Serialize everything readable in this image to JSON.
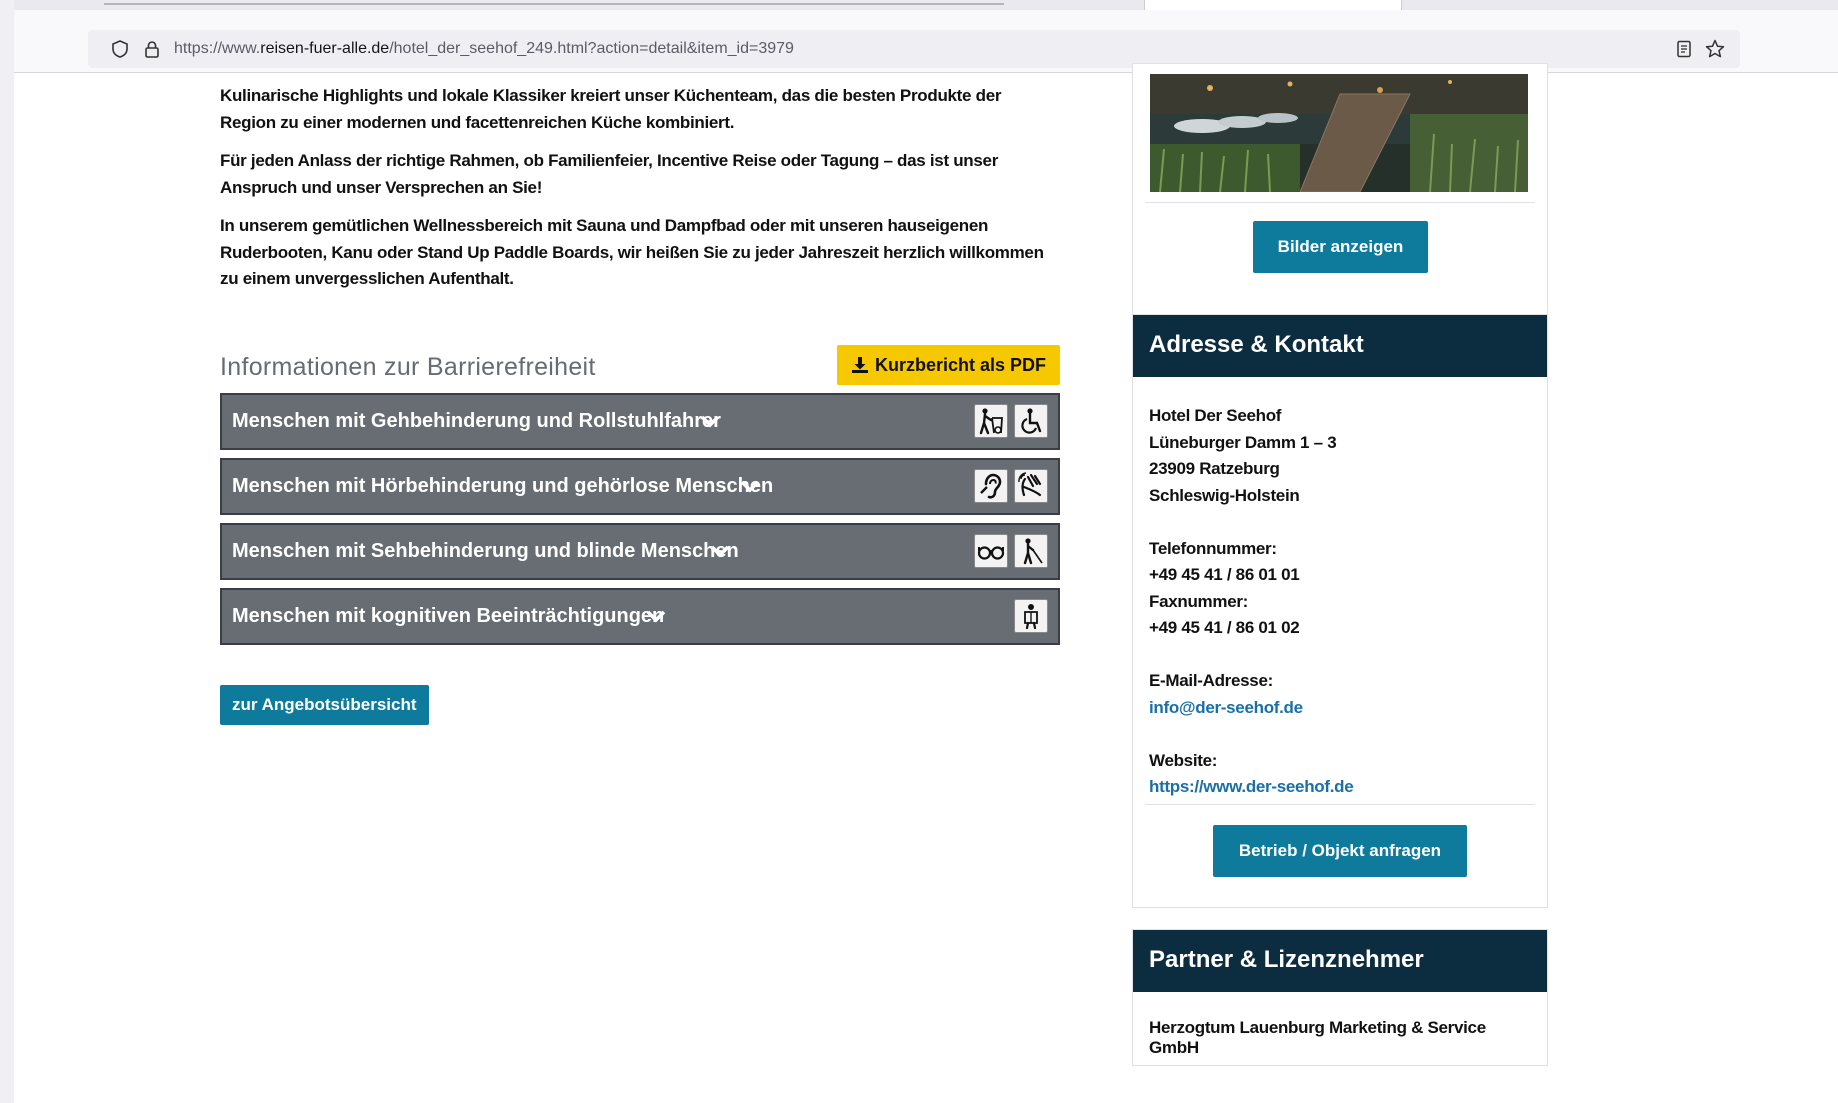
{
  "browser": {
    "url_prefix": "https://www.",
    "url_host": "reisen-fuer-alle.de",
    "url_path": "/hotel_der_seehof_249.html?action=detail&item_id=3979"
  },
  "content": {
    "paragraphs": [
      "Kulinarische Highlights und lokale Klassiker kreiert unser Küchenteam, das die besten Produkte der Region zu einer modernen und facettenreichen Küche kombiniert.",
      "Für jeden Anlass der richtige Rahmen, ob Familienfeier, Incentive Reise oder Tagung – das ist unser Anspruch und unser Versprechen an Sie!",
      "In unserem gemütlichen Wellnessbereich mit Sauna und Dampfbad oder mit unseren hauseigenen Ruderbooten, Kanu oder Stand Up Paddle Boards, wir heißen Sie zu jeder Jahreszeit herzlich willkommen zu einem unvergesslichen Aufenthalt."
    ]
  },
  "accessibility": {
    "title": "Informationen zur Barrierefreiheit",
    "pdf_button": "Kurzbericht als PDF",
    "items": [
      {
        "label": "Menschen mit Gehbehinderung und Rollstuhlfahrer"
      },
      {
        "label": "Menschen mit Hörbehinderung und gehörlose Menschen"
      },
      {
        "label": "Menschen mit Sehbehinderung und blinde Menschen"
      },
      {
        "label": "Menschen mit kognitiven Beeinträchtigungen"
      }
    ],
    "icons": [
      "walking-aid-icon",
      "wheelchair-icon",
      "ear-icon",
      "sign-language-icon",
      "glasses-icon",
      "blind-cane-icon",
      "reading-person-icon"
    ]
  },
  "overview_button": "zur Angebotsübersicht",
  "sidebar": {
    "images_button": "Bilder anzeigen",
    "contact": {
      "title": "Adresse & Kontakt",
      "name": "Hotel Der Seehof",
      "street": "Lüneburger Damm 1 – 3",
      "city": "23909 Ratzeburg",
      "state": "Schleswig-Holstein",
      "phone_label": "Telefonnummer:",
      "phone": "+49 45 41 / 86 01 01",
      "fax_label": "Faxnummer:",
      "fax": "+49 45 41 / 86 01 02",
      "email_label": "E-Mail-Adresse:",
      "email": "info@der-seehof.de",
      "website_label": "Website:",
      "website": "https://www.der-seehof.de",
      "request_button": "Betrieb / Objekt anfragen"
    },
    "partner": {
      "title": "Partner & Lizenznehmer",
      "name": "Herzogtum Lauenburg Marketing & Service GmbH"
    }
  },
  "colors": {
    "accent_blue": "#0f7b9c",
    "header_navy": "#0c2c40",
    "pdf_yellow": "#f6c800",
    "accordion_gray": "#676d72",
    "link_blue": "#1b6fa8"
  }
}
